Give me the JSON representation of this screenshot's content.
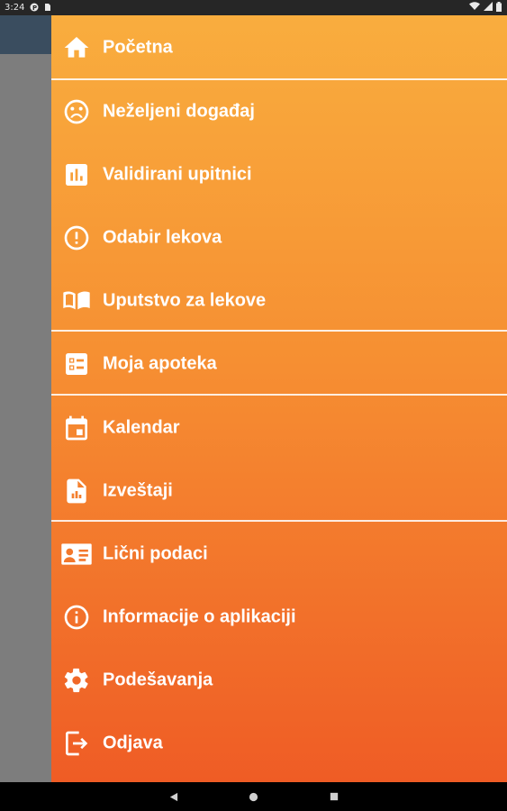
{
  "status_bar": {
    "time": "3:24",
    "icons": [
      "notification-p-icon",
      "sim-card-icon",
      "wifi-icon",
      "signal-icon",
      "battery-icon"
    ]
  },
  "drawer": {
    "background_gradient": [
      "#f9ad3e",
      "#f68f32",
      "#ef5c25"
    ],
    "text_color": "#ffffff",
    "items": [
      {
        "label": "Početna",
        "icon": "home-icon"
      },
      {
        "label": "Neželjeni događaj",
        "icon": "sad-face-icon"
      },
      {
        "label": "Validirani upitnici",
        "icon": "bar-chart-icon"
      },
      {
        "label": "Odabir lekova",
        "icon": "alert-circle-icon"
      },
      {
        "label": "Uputstvo za lekove",
        "icon": "book-icon"
      },
      {
        "label": "Moja apoteka",
        "icon": "list-checklist-icon"
      },
      {
        "label": "Kalendar",
        "icon": "calendar-icon"
      },
      {
        "label": "Izveštaji",
        "icon": "report-file-icon"
      },
      {
        "label": "Lični podaci",
        "icon": "id-card-icon"
      },
      {
        "label": "Informacije o aplikaciji",
        "icon": "info-icon"
      },
      {
        "label": "Podešavanja",
        "icon": "gear-icon"
      },
      {
        "label": "Odjava",
        "icon": "logout-icon"
      }
    ]
  },
  "nav_bar": {
    "buttons": [
      "back-icon",
      "home-circle-icon",
      "recents-icon"
    ]
  }
}
